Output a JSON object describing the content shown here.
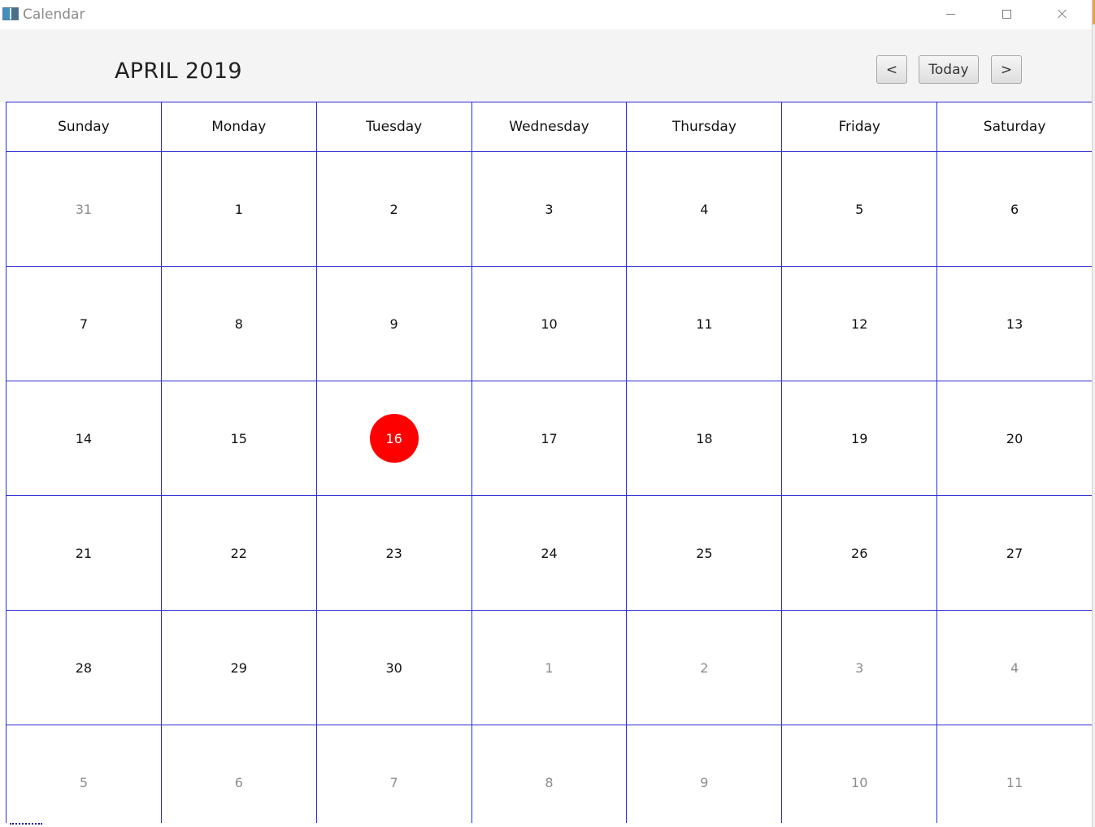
{
  "window": {
    "title": "Calendar",
    "icon": "app-calendar-icon",
    "controls": {
      "minimize": "minimize-icon",
      "maximize": "maximize-icon",
      "close": "close-icon"
    }
  },
  "header": {
    "month_title": "APRIL 2019",
    "prev_label": "<",
    "today_label": "Today",
    "next_label": ">"
  },
  "weekdays": [
    "Sunday",
    "Monday",
    "Tuesday",
    "Wednesday",
    "Thursday",
    "Friday",
    "Saturday"
  ],
  "weeks": [
    [
      {
        "d": "31",
        "other": true
      },
      {
        "d": "1"
      },
      {
        "d": "2"
      },
      {
        "d": "3"
      },
      {
        "d": "4"
      },
      {
        "d": "5"
      },
      {
        "d": "6"
      }
    ],
    [
      {
        "d": "7"
      },
      {
        "d": "8"
      },
      {
        "d": "9"
      },
      {
        "d": "10"
      },
      {
        "d": "11"
      },
      {
        "d": "12"
      },
      {
        "d": "13"
      }
    ],
    [
      {
        "d": "14"
      },
      {
        "d": "15"
      },
      {
        "d": "16",
        "today": true
      },
      {
        "d": "17"
      },
      {
        "d": "18"
      },
      {
        "d": "19"
      },
      {
        "d": "20"
      }
    ],
    [
      {
        "d": "21"
      },
      {
        "d": "22"
      },
      {
        "d": "23"
      },
      {
        "d": "24"
      },
      {
        "d": "25"
      },
      {
        "d": "26"
      },
      {
        "d": "27"
      }
    ],
    [
      {
        "d": "28"
      },
      {
        "d": "29"
      },
      {
        "d": "30"
      },
      {
        "d": "1",
        "other": true
      },
      {
        "d": "2",
        "other": true
      },
      {
        "d": "3",
        "other": true
      },
      {
        "d": "4",
        "other": true
      }
    ],
    [
      {
        "d": "5",
        "other": true
      },
      {
        "d": "6",
        "other": true
      },
      {
        "d": "7",
        "other": true
      },
      {
        "d": "8",
        "other": true
      },
      {
        "d": "9",
        "other": true
      },
      {
        "d": "10",
        "other": true
      },
      {
        "d": "11",
        "other": true
      }
    ]
  ],
  "colors": {
    "grid_border": "#2b2bd6",
    "today_highlight": "#ff0000",
    "other_month_text": "#8c8c8c",
    "header_bg": "#f4f4f4"
  }
}
